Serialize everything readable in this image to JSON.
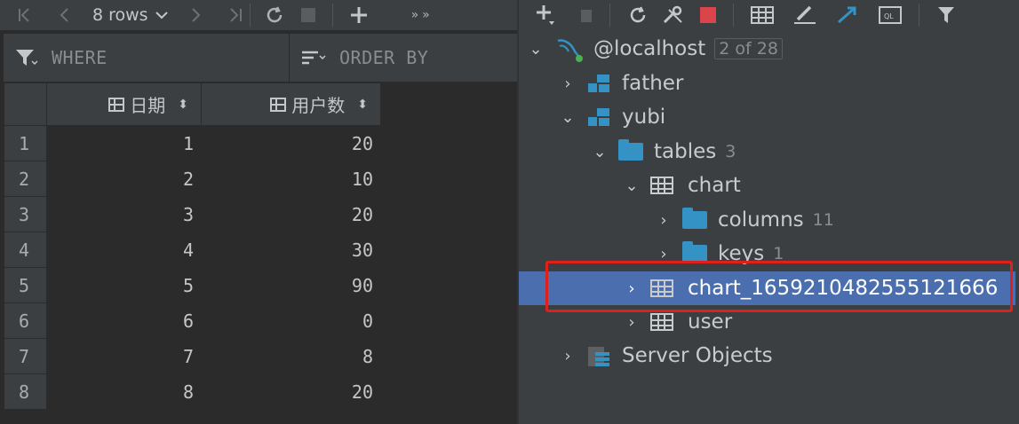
{
  "left_toolbar": {
    "rows_label": "8 rows"
  },
  "filter": {
    "where_label": "WHERE",
    "order_label": "ORDER BY"
  },
  "grid": {
    "columns": [
      "日期",
      "用户数"
    ],
    "rows": [
      {
        "num": "1",
        "a": "1",
        "b": "20"
      },
      {
        "num": "2",
        "a": "2",
        "b": "10"
      },
      {
        "num": "3",
        "a": "3",
        "b": "20"
      },
      {
        "num": "4",
        "a": "4",
        "b": "30"
      },
      {
        "num": "5",
        "a": "5",
        "b": "90"
      },
      {
        "num": "6",
        "a": "6",
        "b": "0"
      },
      {
        "num": "7",
        "a": "7",
        "b": "8"
      },
      {
        "num": "8",
        "a": "8",
        "b": "20"
      }
    ]
  },
  "tree": {
    "host": {
      "label": "@localhost",
      "badge": "2 of 28"
    },
    "father": {
      "label": "father"
    },
    "yubi": {
      "label": "yubi"
    },
    "tables": {
      "label": "tables",
      "count": "3"
    },
    "chart": {
      "label": "chart"
    },
    "columns": {
      "label": "columns",
      "count": "11"
    },
    "keys": {
      "label": "keys",
      "count": "1"
    },
    "chart_table": {
      "label": "chart_1659210482555121666"
    },
    "user": {
      "label": "user"
    },
    "server_objects": {
      "label": "Server Objects"
    }
  },
  "colors": {
    "selection": "#4b6eaf",
    "highlight_box": "#e0201b",
    "folder": "#3592c4"
  }
}
